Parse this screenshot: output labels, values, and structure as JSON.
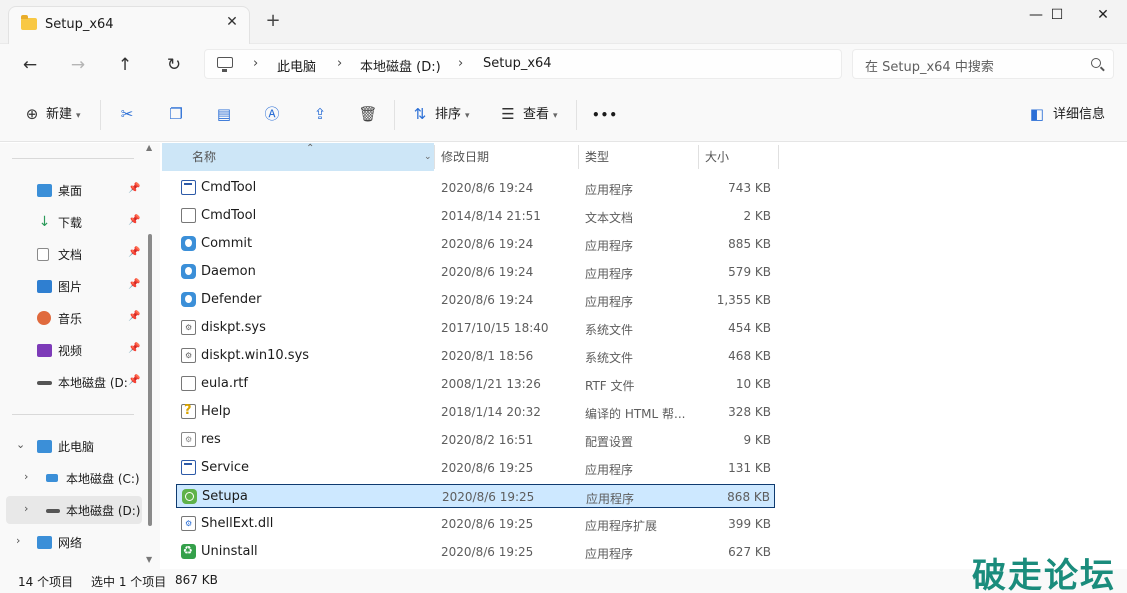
{
  "window": {
    "tab_title": "Setup_x64",
    "tab_close": "✕",
    "new_tab": "+",
    "minimize": "—",
    "maximize": "☐",
    "close": "✕"
  },
  "nav": {
    "back": "←",
    "forward": "→",
    "up": "↑",
    "refresh": "↻"
  },
  "address": {
    "crumbs": [
      "此电脑",
      "本地磁盘 (D:)",
      "Setup_x64"
    ],
    "sep": "›"
  },
  "search": {
    "placeholder": "在 Setup_x64 中搜索"
  },
  "toolbar": {
    "new_label": "新建",
    "sort_label": "排序",
    "view_label": "查看",
    "more": "•••",
    "details_label": "详细信息",
    "icons": [
      "cut-icon",
      "copy-icon",
      "paste-icon",
      "rename-icon",
      "share-icon",
      "delete-icon"
    ]
  },
  "sidebar": {
    "quick_access": [
      {
        "label": "桌面",
        "color": "#3b8fd8"
      },
      {
        "label": "下载",
        "color": "#2b9a5a"
      },
      {
        "label": "文档",
        "color": "#8a8a8a"
      },
      {
        "label": "图片",
        "color": "#2f7fd1"
      },
      {
        "label": "音乐",
        "color": "#e06a3d"
      },
      {
        "label": "视频",
        "color": "#7d3bb8"
      },
      {
        "label": "本地磁盘 (D:",
        "color": "#555555"
      }
    ],
    "pin": "📌",
    "tree": [
      {
        "label": "此电脑",
        "expand": "⌄"
      },
      {
        "label": "本地磁盘 (C:)",
        "expand": "›"
      },
      {
        "label": "本地磁盘 (D:)",
        "expand": "›"
      },
      {
        "label": "网络",
        "expand": "›"
      }
    ]
  },
  "columns": {
    "name": "名称",
    "date": "修改日期",
    "type": "类型",
    "size": "大小",
    "sort_arrow": "⌃"
  },
  "files": [
    {
      "name": "CmdTool",
      "date": "2020/8/6 19:24",
      "type": "应用程序",
      "size": "743 KB",
      "icon": "exe-icon"
    },
    {
      "name": "CmdTool",
      "date": "2014/8/14 21:51",
      "type": "文本文档",
      "size": "2 KB",
      "icon": "text-file-icon"
    },
    {
      "name": "Commit",
      "date": "2020/8/6 19:24",
      "type": "应用程序",
      "size": "885 KB",
      "icon": "app-icon"
    },
    {
      "name": "Daemon",
      "date": "2020/8/6 19:24",
      "type": "应用程序",
      "size": "579 KB",
      "icon": "app-icon"
    },
    {
      "name": "Defender",
      "date": "2020/8/6 19:24",
      "type": "应用程序",
      "size": "1,355 KB",
      "icon": "app-icon"
    },
    {
      "name": "diskpt.sys",
      "date": "2017/10/15 18:40",
      "type": "系统文件",
      "size": "454 KB",
      "icon": "sys-file-icon"
    },
    {
      "name": "diskpt.win10.sys",
      "date": "2020/8/1 18:56",
      "type": "系统文件",
      "size": "468 KB",
      "icon": "sys-file-icon"
    },
    {
      "name": "eula.rtf",
      "date": "2008/1/21 13:26",
      "type": "RTF 文件",
      "size": "10 KB",
      "icon": "rtf-file-icon"
    },
    {
      "name": "Help",
      "date": "2018/1/14 20:32",
      "type": "编译的 HTML 帮...",
      "size": "328 KB",
      "icon": "help-file-icon"
    },
    {
      "name": "res",
      "date": "2020/8/2 16:51",
      "type": "配置设置",
      "size": "9 KB",
      "icon": "config-file-icon"
    },
    {
      "name": "Service",
      "date": "2020/8/6 19:25",
      "type": "应用程序",
      "size": "131 KB",
      "icon": "exe-icon"
    },
    {
      "name": "Setupa",
      "date": "2020/8/6 19:25",
      "type": "应用程序",
      "size": "868 KB",
      "icon": "setup-icon",
      "selected": true
    },
    {
      "name": "ShellExt.dll",
      "date": "2020/8/6 19:25",
      "type": "应用程序扩展",
      "size": "399 KB",
      "icon": "dll-file-icon"
    },
    {
      "name": "Uninstall",
      "date": "2020/8/6 19:25",
      "type": "应用程序",
      "size": "627 KB",
      "icon": "uninstall-icon"
    }
  ],
  "status": {
    "count": "14 个项目",
    "selected": "选中 1 个项目",
    "size": "867 KB"
  },
  "watermark": "破走论坛"
}
